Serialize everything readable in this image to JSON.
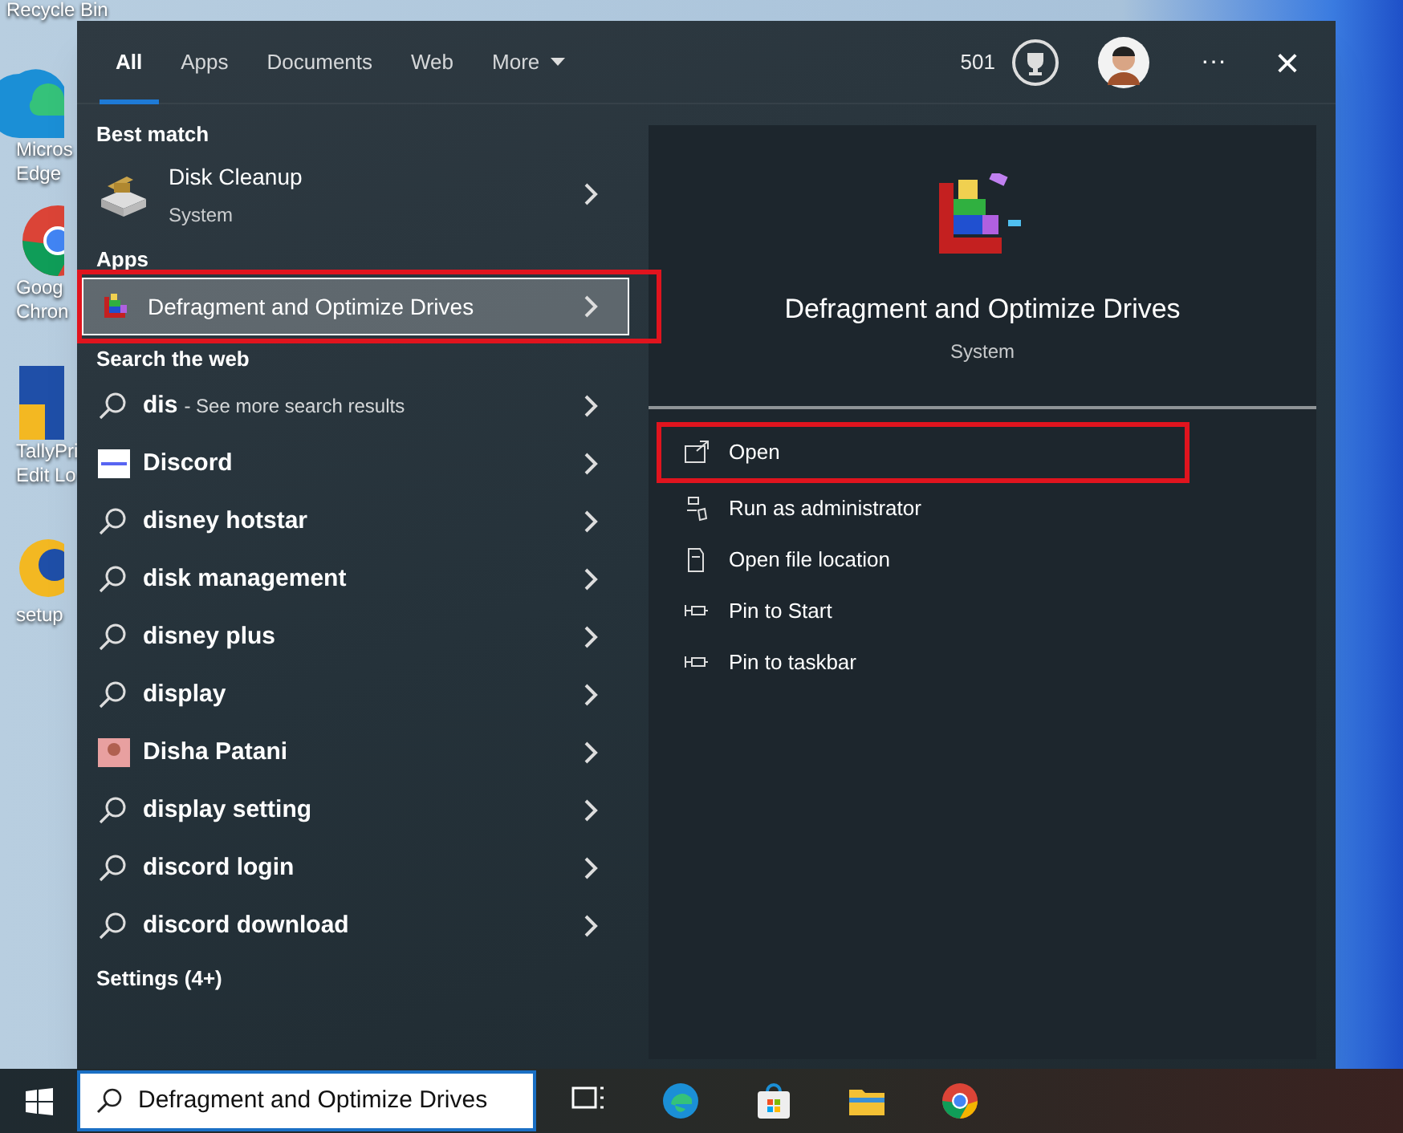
{
  "desktop_icons": [
    {
      "kind": "bin",
      "lines": [
        "Recycle Bin"
      ]
    },
    {
      "kind": "edge",
      "lines": [
        "Micros",
        "Edge"
      ]
    },
    {
      "kind": "chrome",
      "lines": [
        "Goog",
        "Chron"
      ]
    },
    {
      "kind": "tally",
      "lines": [
        "TallyPri",
        "Edit Lo"
      ]
    },
    {
      "kind": "setup",
      "lines": [
        "setup"
      ]
    }
  ],
  "tabs": [
    {
      "label": "All",
      "selected": true
    },
    {
      "label": "Apps",
      "selected": false
    },
    {
      "label": "Documents",
      "selected": false
    },
    {
      "label": "Web",
      "selected": false
    },
    {
      "label": "More",
      "selected": false,
      "dropdown": true
    }
  ],
  "header": {
    "points": "501",
    "more": "···",
    "close": "×"
  },
  "sections": [
    {
      "heading": "Best match",
      "items": [
        {
          "kind": "disk",
          "title": "Disk Cleanup",
          "subtitle": "System",
          "selected": false,
          "annotated": false
        }
      ]
    },
    {
      "heading": "Apps",
      "items": [
        {
          "kind": "defrag",
          "title": "Defragment and Optimize Drives",
          "selected": true,
          "annotated": true
        }
      ]
    },
    {
      "heading": "Search the web",
      "items": [
        {
          "kind": "search",
          "title": "dis",
          "hint": "- See more search results",
          "selected": false,
          "annotated": false
        },
        {
          "kind": "logo",
          "title": "Discord",
          "selected": false,
          "annotated": false
        },
        {
          "kind": "search",
          "title": "disney hotstar",
          "selected": false,
          "annotated": false
        },
        {
          "kind": "search",
          "title": "disk management",
          "selected": false,
          "annotated": false
        },
        {
          "kind": "search",
          "title": "disney plus",
          "selected": false,
          "annotated": false
        },
        {
          "kind": "search",
          "title": "display",
          "selected": false,
          "annotated": false
        },
        {
          "kind": "photo",
          "title": "Disha Patani",
          "selected": false,
          "annotated": false
        },
        {
          "kind": "search",
          "title": "display setting",
          "selected": false,
          "annotated": false
        },
        {
          "kind": "search",
          "title": "discord login",
          "selected": false,
          "annotated": false
        },
        {
          "kind": "search",
          "title": "discord download",
          "selected": false,
          "annotated": false
        }
      ]
    },
    {
      "heading": "Settings (4+)"
    }
  ],
  "preview": {
    "title": "Defragment and Optimize Drives",
    "subtitle": "System",
    "actions": [
      {
        "kind": "open",
        "label": "Open",
        "annotated": true
      },
      {
        "kind": "admin",
        "label": "Run as administrator",
        "annotated": false
      },
      {
        "kind": "folder",
        "label": "Open file location",
        "annotated": false
      },
      {
        "kind": "pin",
        "label": "Pin to Start",
        "annotated": false
      },
      {
        "kind": "pin",
        "label": "Pin to taskbar",
        "annotated": false
      }
    ]
  },
  "taskbar": {
    "search_value": "Defragment and Optimize Drives",
    "apps": [
      {
        "kind": "taskview"
      },
      {
        "kind": "edge"
      },
      {
        "kind": "store"
      },
      {
        "kind": "folder"
      },
      {
        "kind": "chrome"
      }
    ]
  }
}
